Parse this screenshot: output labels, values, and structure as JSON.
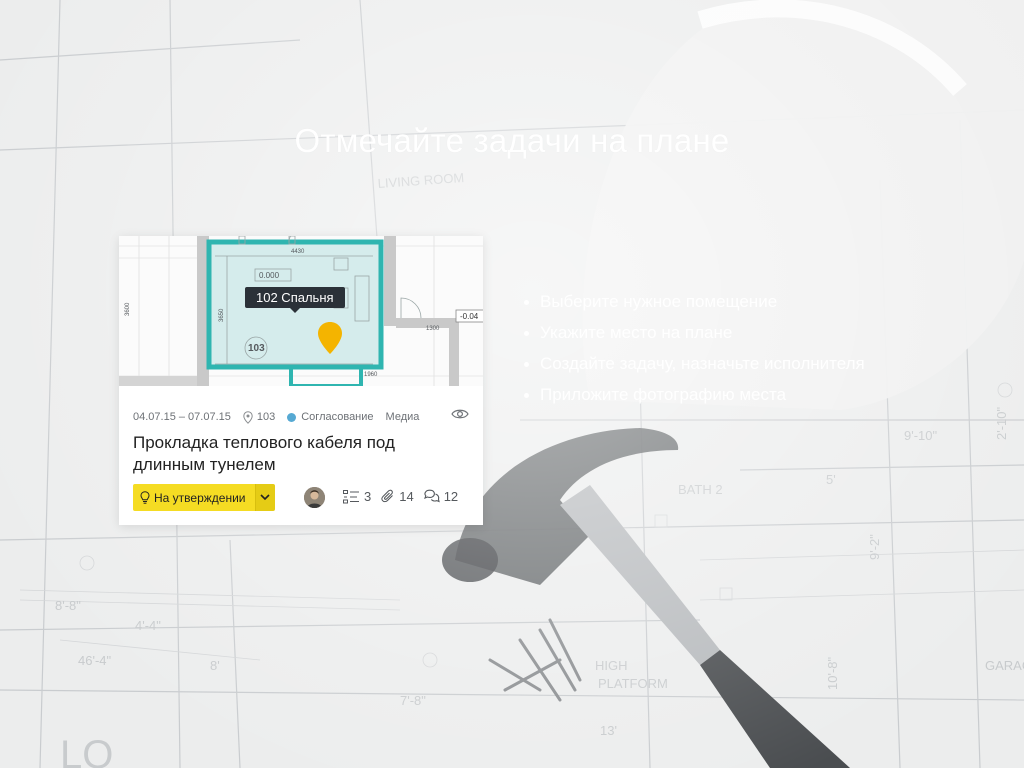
{
  "headline": "Отмечайте задачи на плане",
  "features": [
    "Выберите нужное помещение",
    "Укажите место на плане",
    "Создайте задачу, назначьте исполнителя",
    "Приложите фотографию места"
  ],
  "card": {
    "room_label": "102 Спальня",
    "room_number": "103",
    "plan_value": "0.000",
    "plan_dimension": "4430",
    "plan_level": "-0.04",
    "dates": "04.07.15 – 07.07.15",
    "location": "103",
    "status": "Согласование",
    "status_color": "#56a9d3",
    "media": "Медиа",
    "title": "Прокладка теплового кабеля под длинным тунелем",
    "approve_label": "На утверждении",
    "accent_color": "#f5dc23",
    "subtasks_count": "3",
    "attachments_count": "14",
    "comments_count": "12"
  }
}
